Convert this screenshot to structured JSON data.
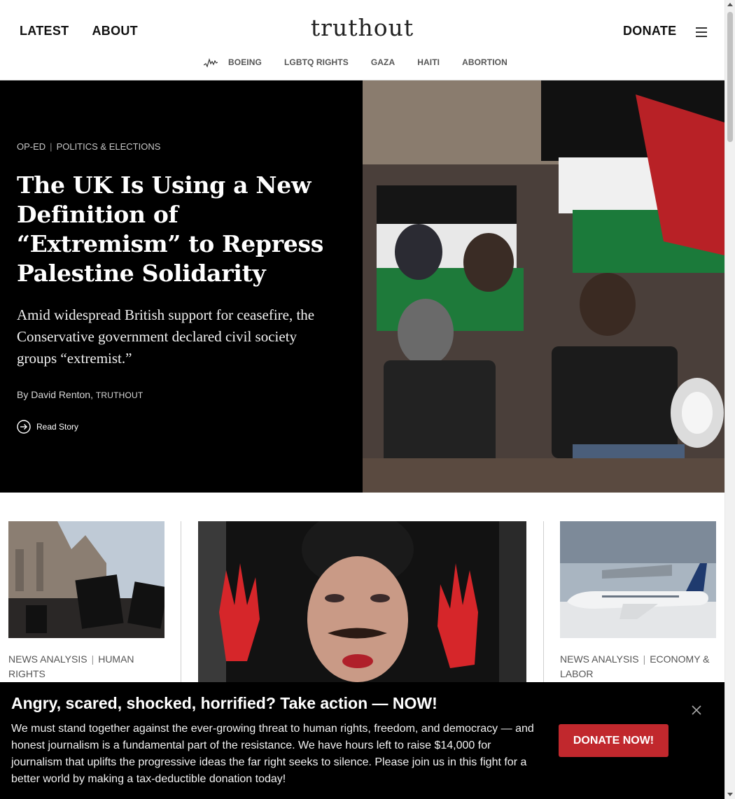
{
  "header": {
    "nav": [
      "LATEST",
      "ABOUT"
    ],
    "logo": "truthout",
    "donate_label": "DONATE",
    "menu_icon": "hamburger-icon",
    "trending_icon": "trend-line-icon",
    "topics": [
      "BOEING",
      "LGBTQ RIGHTS",
      "GAZA",
      "HAITI",
      "ABORTION"
    ]
  },
  "hero": {
    "tags": [
      "OP-ED",
      "POLITICS & ELECTIONS"
    ],
    "title": "The UK Is Using a New Definition of “Extremism” to Repress Palestine Solidarity",
    "dek": "Amid widespread British support for ceasefire, the Conservative government declared civil society groups “extremist.”",
    "byline_prefix": "By",
    "author": "David Renton",
    "author_sep": ",",
    "org": "Truthout",
    "read_label": "Read Story",
    "read_icon": "arrow-circle-icon"
  },
  "cards": [
    {
      "tags": [
        "NEWS ANALYSIS",
        "HUMAN RIGHTS"
      ]
    },
    {
      "tags": []
    },
    {
      "tags": [
        "NEWS ANALYSIS",
        "ECONOMY & LABOR"
      ]
    }
  ],
  "banner": {
    "title": "Angry, scared, shocked, horrified? Take action — NOW!",
    "body": "We must stand together against the ever-growing threat to human rights, freedom, and democracy — and honest journalism is a fundamental part of the resistance. We have hours left to raise $14,000 for journalism that uplifts the progressive ideas the far right seeks to silence. Please join us in this fight for a better world by making a tax-deductible donation today!",
    "button_label": "DONATE NOW!",
    "close_icon": "close-icon"
  },
  "colors": {
    "accent": "#c1282d",
    "hero_bg": "#000000",
    "tag_gray": "#555555"
  }
}
